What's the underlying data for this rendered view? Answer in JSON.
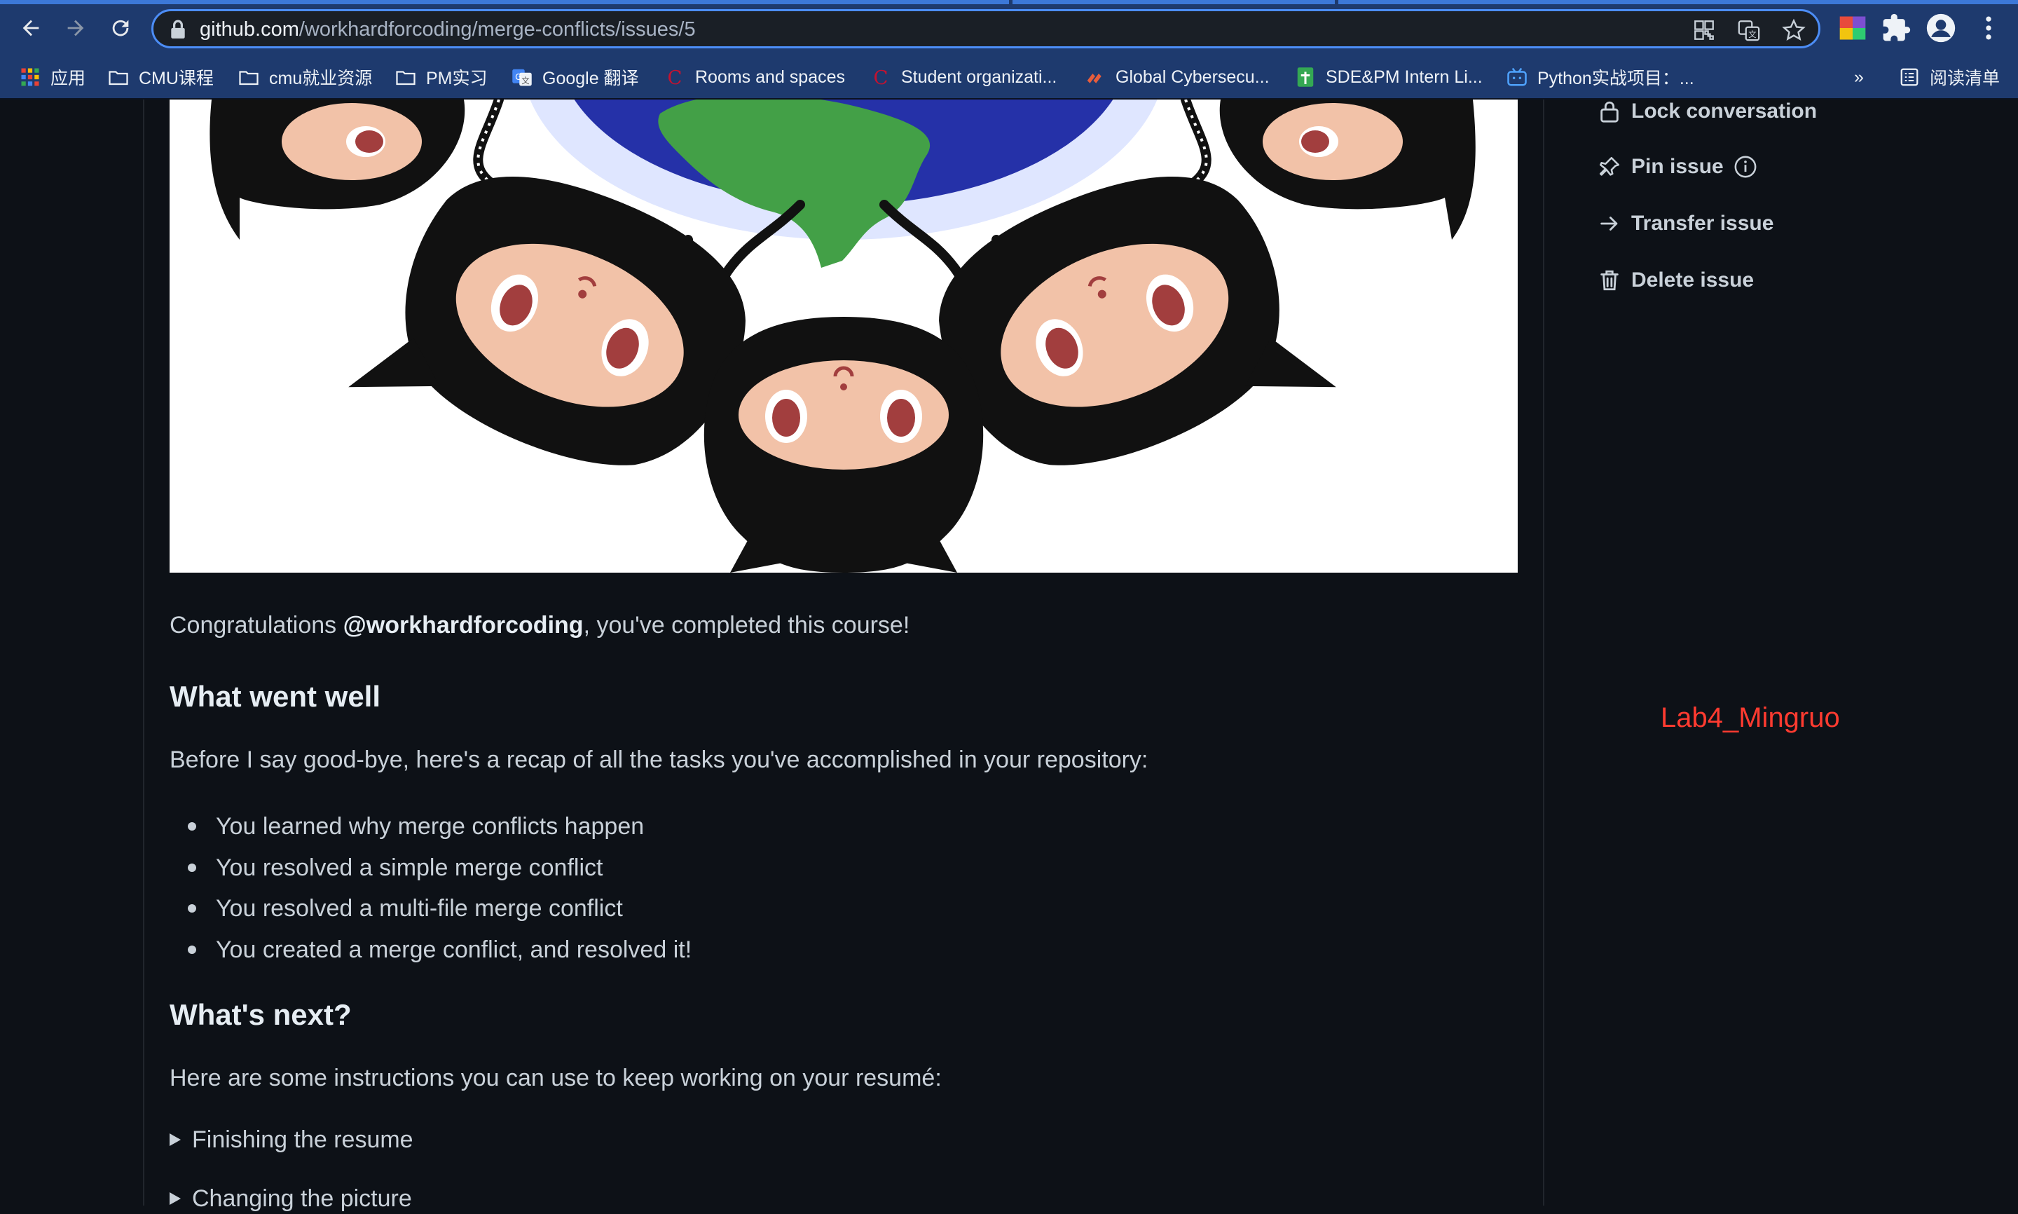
{
  "browser": {
    "url_host": "github.com",
    "url_path": "/workhardforcoding/merge-conflicts/issues/5",
    "bookmarks": [
      {
        "label": "应用",
        "icon": "apps-grid-icon"
      },
      {
        "label": "CMU课程",
        "icon": "folder-icon"
      },
      {
        "label": "cmu就业资源",
        "icon": "folder-icon"
      },
      {
        "label": "PM实习",
        "icon": "folder-icon"
      },
      {
        "label": "Google 翻译",
        "icon": "google-translate-icon"
      },
      {
        "label": "Rooms and spaces",
        "icon": "cmu-logo-icon"
      },
      {
        "label": "Student organizati...",
        "icon": "cmu-logo-icon"
      },
      {
        "label": "Global Cybersecu...",
        "icon": "cyber-logo-icon"
      },
      {
        "label": "SDE&PM Intern Li...",
        "icon": "sheets-icon"
      },
      {
        "label": "Python实战项目：...",
        "icon": "bilibili-icon"
      },
      {
        "label": "阅读清单",
        "icon": "reading-list-icon"
      }
    ],
    "overflow_label": "»"
  },
  "issue": {
    "congrats_prefix": "Congratulations ",
    "congrats_user": "@workhardforcoding",
    "congrats_suffix": ", you've completed this course!",
    "h_went_well": "What went well",
    "recap": "Before I say good-bye, here's a recap of all the tasks you've accomplished in your repository:",
    "tasks": [
      "You learned why merge conflicts happen",
      "You resolved a simple merge conflict",
      "You resolved a multi-file merge conflict",
      "You created a merge conflict, and resolved it!"
    ],
    "h_next": "What's next?",
    "next_intro": "Here are some instructions you can use to keep working on your resumé:",
    "details": [
      "Finishing the resume",
      "Changing the picture"
    ]
  },
  "sidebar": {
    "lock": "Lock conversation",
    "pin": "Pin issue",
    "transfer": "Transfer issue",
    "delete": "Delete issue"
  },
  "watermark": "Lab4_Mingruo",
  "colors": {
    "page_bg": "#0d1117",
    "chrome_bg": "#1e3a6e",
    "omnibox_border": "#4c8df6",
    "watermark": "#ff3b30"
  }
}
